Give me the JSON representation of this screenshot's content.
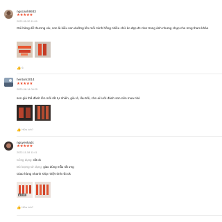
{
  "reviews": [
    {
      "username": "ngocanh9933",
      "stars": "★★★★★",
      "date": "2022-05-20 11:09",
      "text": "Gói hàng dễ thương xỉu, son là kiểu son dưỡng lên môi mình hồng nhiều chứ ko đẹp đc như trong ảnh nhưng chụp cho mng tham khảo",
      "likes": "6"
    },
    {
      "username": "hentum2014",
      "stars": "★★★★★",
      "date": "2023-08-14 09:25",
      "text": "son giá thấ đánh lên môi rất tự nhiên, giá rẻ, lâu trôi, cho ai lười đánh son nên mua nhé",
      "likes": "Hữu ích?"
    },
    {
      "username": "nguyenkadc",
      "stars": "★★★★★",
      "date": "2022-11-18 11:41",
      "attr1_key": "Công dụng:",
      "attr1_val": "rất ok",
      "attr2_key": "Đủ lượng sử dụng:",
      "attr2_val": "giao đúng mẫu rất ưng",
      "text": "Giao hàng nhanh ship nhiệt tình rất ok",
      "video_duration": "0:04",
      "likes": "Hữu ích?"
    }
  ],
  "colors": {
    "star": "#ee4d2d",
    "meta": "#9a9a9a"
  },
  "icons": {
    "like": "thumb-up-icon",
    "play": "play-icon"
  }
}
